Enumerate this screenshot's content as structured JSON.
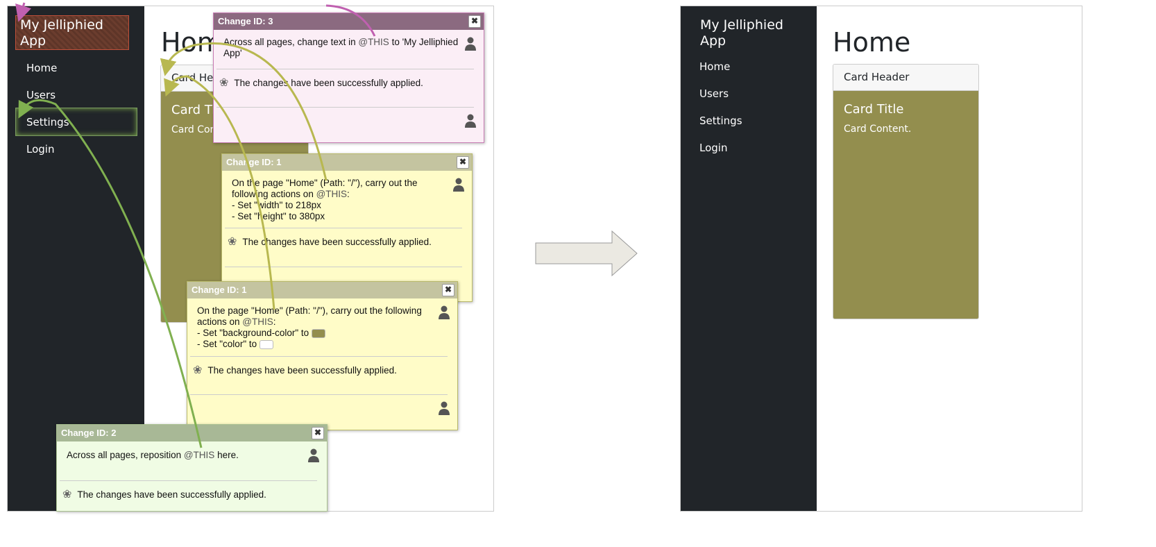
{
  "app": {
    "brand": "My Jelliphied App",
    "nav": [
      "Home",
      "Users",
      "Settings",
      "Login"
    ],
    "page_title": "Home",
    "card": {
      "header": "Card Header",
      "header_clipped": "Card He",
      "title": "Card Title",
      "title_clipped": "Card T",
      "content": "Card Content.",
      "content_clipped": "Card Co"
    }
  },
  "popups": [
    {
      "id_label": "Change ID:  3",
      "message_pre": "Across all pages, change text in ",
      "this": "@THIS",
      "message_post": " to 'My Jelliphied App'",
      "status": "The changes have been successfully applied.",
      "header_color": "#8b6a80",
      "body_color": "#fbeef6"
    },
    {
      "id_label": "Change ID:  1",
      "message_pre": "On the page \"Home\" (Path: \"/\"), carry out the following actions on ",
      "this": "@THIS",
      "message_post": ":",
      "actions": [
        "- Set \"width\" to 218px",
        "- Set \"height\" to 380px"
      ],
      "status": "The changes have been successfully applied.",
      "header_color": "#c4c4a0",
      "body_color": "#fffcc8"
    },
    {
      "id_label": "Change ID:  1",
      "message_pre": "On the page \"Home\" (Path: \"/\"), carry out the following actions on ",
      "this": "@THIS",
      "message_post": ":",
      "actions": [
        "- Set \"background-color\" to ",
        "- Set \"color\" to "
      ],
      "swatches": [
        "#938e4e",
        "#ffffff"
      ],
      "status": "The changes have been successfully applied.",
      "header_color": "#c4c4a0",
      "body_color": "#fffcc8"
    },
    {
      "id_label": "Change ID:  2",
      "message_pre": "Across all pages, reposition ",
      "this": "@THIS",
      "message_post": " here.",
      "status": "The changes have been successfully applied.",
      "header_color": "#a8b896",
      "body_color": "#f0fce4"
    }
  ],
  "close_glyph": "✖"
}
